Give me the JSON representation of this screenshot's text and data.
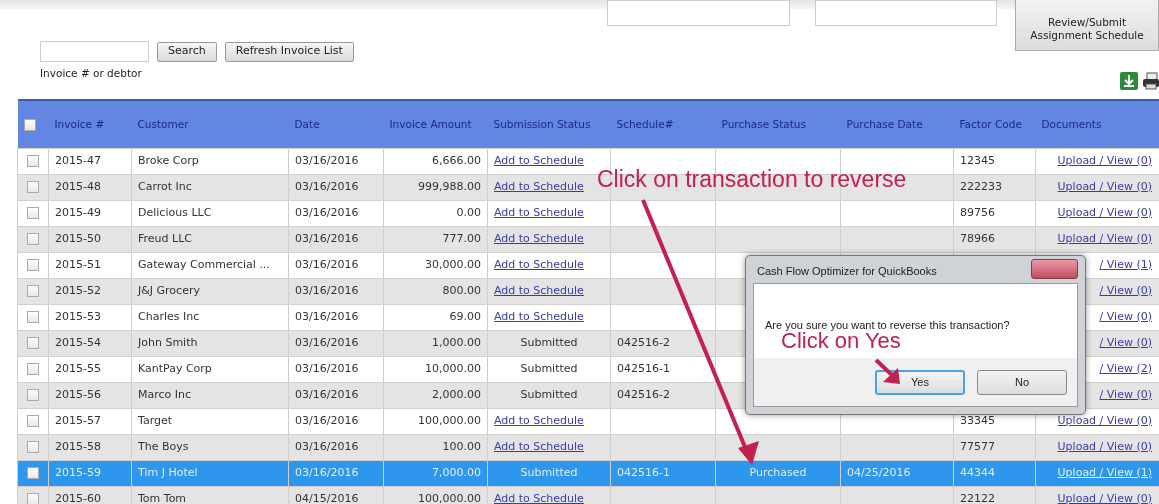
{
  "top_controls": {
    "review_button": "Review/Submit Assignment Schedule"
  },
  "search": {
    "button": "Search",
    "hint": "Invoice # or debtor",
    "refresh_button": "Refresh Invoice List"
  },
  "table": {
    "select_all_checked": false,
    "columns": [
      "Invoice #",
      "Customer",
      "Date",
      "Invoice Amount",
      "Submission Status",
      "Schedule#",
      "Purchase Status",
      "Purchase Date",
      "Factor Code",
      "Documents"
    ],
    "rows": [
      {
        "checked": false,
        "selected": false,
        "invoice": "2015-47",
        "customer": "Broke Corp",
        "date": "03/16/2016",
        "amount": "6,666.00",
        "submission": {
          "kind": "link",
          "text": "Add to Schedule"
        },
        "factor_code": "12345",
        "documents": "Upload / View (0)"
      },
      {
        "checked": false,
        "selected": false,
        "invoice": "2015-48",
        "customer": "Carrot Inc",
        "date": "03/16/2016",
        "amount": "999,988.00",
        "submission": {
          "kind": "link",
          "text": "Add to Schedule"
        },
        "factor_code": "222233",
        "documents": "Upload / View (0)"
      },
      {
        "checked": false,
        "selected": false,
        "invoice": "2015-49",
        "customer": "Delicious LLC",
        "date": "03/16/2016",
        "amount": "0.00",
        "submission": {
          "kind": "link",
          "text": "Add to Schedule"
        },
        "factor_code": "89756",
        "documents": "Upload / View (0)"
      },
      {
        "checked": false,
        "selected": false,
        "invoice": "2015-50",
        "customer": "Freud LLC",
        "date": "03/16/2016",
        "amount": "777.00",
        "submission": {
          "kind": "link",
          "text": "Add to Schedule"
        },
        "factor_code": "78966",
        "documents": "Upload / View (0)"
      },
      {
        "checked": false,
        "selected": false,
        "invoice": "2015-51",
        "customer": "Gateway Commercial ...",
        "date": "03/16/2016",
        "amount": "30,000.00",
        "submission": {
          "kind": "link",
          "text": "Add to Schedule"
        },
        "documents": "/ View (1)"
      },
      {
        "checked": false,
        "selected": false,
        "invoice": "2015-52",
        "customer": "J&J Grocery",
        "date": "03/16/2016",
        "amount": "800.00",
        "submission": {
          "kind": "link",
          "text": "Add to Schedule"
        },
        "documents": "/ View (0)"
      },
      {
        "checked": false,
        "selected": false,
        "invoice": "2015-53",
        "customer": "Charles Inc",
        "date": "03/16/2016",
        "amount": "69.00",
        "submission": {
          "kind": "link",
          "text": "Add to Schedule"
        },
        "documents": "/ View (0)"
      },
      {
        "checked": false,
        "selected": false,
        "invoice": "2015-54",
        "customer": "John Smith",
        "date": "03/16/2016",
        "amount": "1,000.00",
        "submission": {
          "kind": "status",
          "text": "Submitted"
        },
        "schedule": "042516-2",
        "documents": "/ View (0)"
      },
      {
        "checked": false,
        "selected": false,
        "invoice": "2015-55",
        "customer": "KantPay Corp",
        "date": "03/16/2016",
        "amount": "10,000.00",
        "submission": {
          "kind": "status",
          "text": "Submitted"
        },
        "schedule": "042516-1",
        "documents": "/ View (2)"
      },
      {
        "checked": false,
        "selected": false,
        "invoice": "2015-56",
        "customer": "Marco Inc",
        "date": "03/16/2016",
        "amount": "2,000.00",
        "submission": {
          "kind": "status",
          "text": "Submitted"
        },
        "schedule": "042516-2",
        "documents": "/ View (0)"
      },
      {
        "checked": false,
        "selected": false,
        "invoice": "2015-57",
        "customer": "Target",
        "date": "03/16/2016",
        "amount": "100,000.00",
        "submission": {
          "kind": "link",
          "text": "Add to Schedule"
        },
        "factor_code": "33345",
        "documents": "Upload / View (0)"
      },
      {
        "checked": false,
        "selected": false,
        "invoice": "2015-58",
        "customer": "The Boys",
        "date": "03/16/2016",
        "amount": "100.00",
        "submission": {
          "kind": "link",
          "text": "Add to Schedule"
        },
        "factor_code": "77577",
        "documents": "Upload / View (0)"
      },
      {
        "checked": false,
        "selected": true,
        "invoice": "2015-59",
        "customer": "Tim J Hotel",
        "date": "03/16/2016",
        "amount": "7,000.00",
        "submission": {
          "kind": "status",
          "text": "Submitted"
        },
        "schedule": "042516-1",
        "purchase_status": "Purchased",
        "purchase_date": "04/25/2016",
        "factor_code": "44344",
        "documents": "Upload / View (1)"
      },
      {
        "checked": false,
        "selected": false,
        "invoice": "2015-60",
        "customer": "Tom Tom",
        "date": "04/15/2016",
        "amount": "100,000.00",
        "submission": {
          "kind": "link",
          "text": "Add to Schedule"
        },
        "factor_code": "22122",
        "documents": "Upload / View (0)"
      }
    ]
  },
  "dialog": {
    "title": "Cash Flow Optimizer for QuickBooks",
    "message": "Are you sure you want to reverse this transaction?",
    "buttons": [
      {
        "label": "Yes",
        "focused": true
      },
      {
        "label": "No",
        "focused": false
      }
    ]
  },
  "annotations": [
    {
      "text": "Click on transaction to reverse"
    },
    {
      "text": "Click on Yes"
    }
  ]
}
